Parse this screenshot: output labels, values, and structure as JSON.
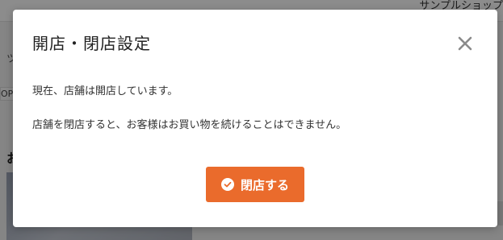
{
  "background": {
    "shop_name": "サンプルショップ",
    "left_char": "ツ",
    "left_op": "OP",
    "left_bold": "お"
  },
  "modal": {
    "title": "開店・閉店設定",
    "message_status": "現在、店舗は開店しています。",
    "message_warning": "店舗を閉店すると、お客様はお買い物を続けることはできません。",
    "primary_button_label": "閉店する",
    "close_icon": "close-icon",
    "button_icon": "check-circle-icon",
    "accent_color": "#ea6b2c"
  }
}
